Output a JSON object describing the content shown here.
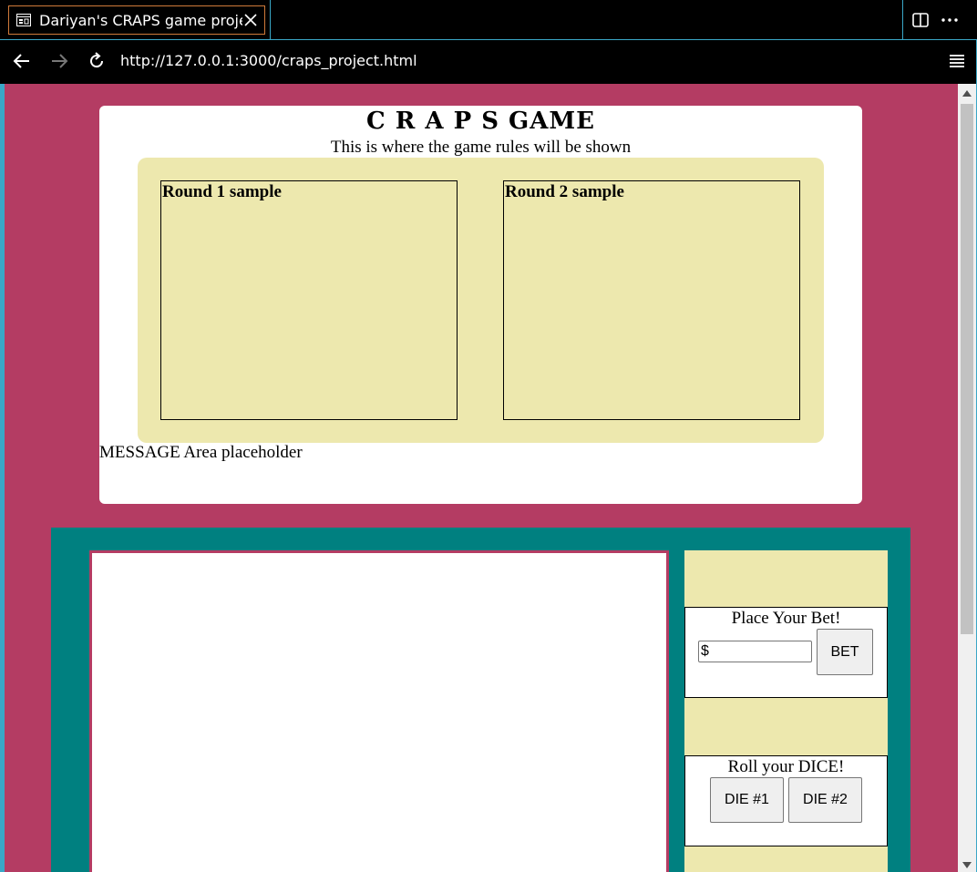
{
  "browser": {
    "tab_title": "Dariyan's CRAPS game project",
    "url": "http://127.0.0.1:3000/craps_project.html"
  },
  "page": {
    "title": "C R A P S GAME",
    "rules_text": "This is where the game rules will be shown",
    "samples": [
      {
        "label": "Round 1 sample"
      },
      {
        "label": "Round 2 sample"
      }
    ],
    "message": "MESSAGE Area placeholder",
    "bet_panel": {
      "title": "Place Your Bet!",
      "input_value": "$",
      "button_label": "BET"
    },
    "dice_panel": {
      "title": "Roll your DICE!",
      "die1_label": "DIE #1",
      "die2_label": "DIE #2"
    }
  },
  "colors": {
    "page_bg": "#b43c63",
    "table_bg": "#008080",
    "khaki": "#ede8ae",
    "chrome_accent": "#3aa7c7"
  },
  "icons": {
    "tab": "page-icon",
    "close": "close-icon",
    "split": "split-screen-icon",
    "more": "more-options-icon",
    "back": "back-arrow-icon",
    "forward": "forward-arrow-icon",
    "reload": "reload-icon",
    "menu": "menu-icon"
  }
}
